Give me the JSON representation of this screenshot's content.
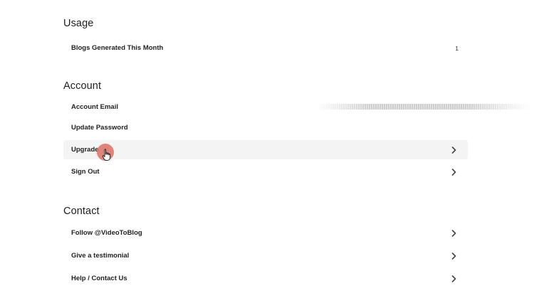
{
  "usage": {
    "title": "Usage",
    "rows": [
      {
        "label": "Blogs Generated This Month",
        "value": "1"
      }
    ]
  },
  "account": {
    "title": "Account",
    "rows": [
      {
        "label": "Account Email"
      },
      {
        "label": "Update Password"
      },
      {
        "label": "Upgrade"
      },
      {
        "label": "Sign Out"
      }
    ]
  },
  "contact": {
    "title": "Contact",
    "rows": [
      {
        "label": "Follow @VideoToBlog"
      },
      {
        "label": "Give a testimonial"
      },
      {
        "label": "Help / Contact Us"
      }
    ]
  },
  "icons": {
    "chevron": "chevron-right-icon",
    "cursor": "hand-pointer-icon"
  },
  "colors": {
    "cursor_highlight": "#dc6e64",
    "hover_row": "#f4f4f4"
  }
}
